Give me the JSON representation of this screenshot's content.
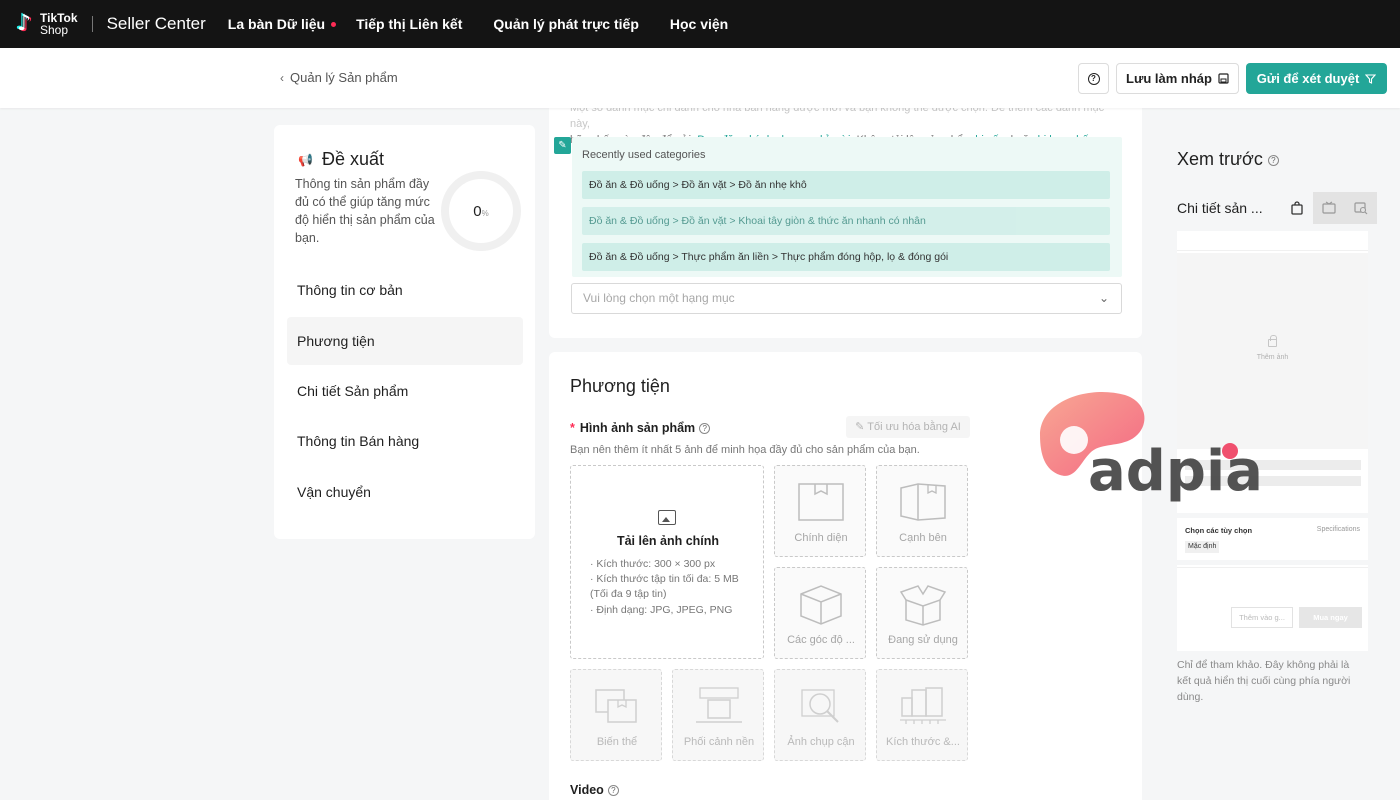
{
  "topnav": {
    "logo_word1": "TikTok",
    "logo_word2": "Shop",
    "brand": "Seller Center",
    "items": [
      {
        "label": "La bàn Dữ liệu",
        "has_dot": true
      },
      {
        "label": "Tiếp thị Liên kết"
      },
      {
        "label": "Quản lý phát trực tiếp"
      },
      {
        "label": "Học viện"
      }
    ]
  },
  "subheader": {
    "back_label": "Quản lý Sản phẩm",
    "help_icon": "question-circle-icon",
    "draft_label": "Lưu làm nháp",
    "submit_label": "Gửi để xét duyệt"
  },
  "colors": {
    "accent": "#23a698",
    "nav_bg": "#141414",
    "required": "#fe2c55"
  },
  "sidebar": {
    "title": "Đề xuất",
    "description": "Thông tin sản phẩm đầy đủ có thể giúp tăng mức độ hiển thị sản phẩm của bạn.",
    "progress_value": "0",
    "progress_unit": "%",
    "progress_fraction": 0,
    "items": [
      {
        "label": "Thông tin cơ bản"
      },
      {
        "label": "Phương tiện",
        "active": true
      },
      {
        "label": "Chi tiết Sản phẩm"
      },
      {
        "label": "Thông tin Bán hàng"
      },
      {
        "label": "Vận chuyển"
      }
    ]
  },
  "category": {
    "note_line1": "Một số danh mục chỉ dành cho nhà bán hàng được mời và bạn không thể được chọn. Để thêm các danh mục này,",
    "note_line2_a": "hãy nhấp vào đây để gửi: ",
    "note_link1": "Đơn đăng ký danh mục chỉ mời",
    "note_line2_b": ". Không tải lên sản phẩm ",
    "note_link2": "bị cấm",
    "note_line2_c": " hoặc ",
    "note_link3": "bị hạn chế",
    "note_line2_d": ".",
    "recent_heading": "Recently used categories",
    "recent": [
      "Đồ ăn & Đồ uống > Đồ ăn vặt > Đồ ăn nhẹ khô",
      "Đồ ăn & Đồ uống > Đồ ăn vặt > Khoai tây giòn & thức ăn nhanh có nhân",
      "Đồ ăn & Đồ uống > Thực phẩm ăn liền > Thực phẩm đóng hộp, lọ & đóng gói"
    ],
    "select_placeholder": "Vui lòng chọn một hạng mục"
  },
  "media": {
    "title": "Phương tiện",
    "images_label": "Hình ảnh sản phẩm",
    "ai_button": "Tối ưu hóa bằng AI",
    "images_hint": "Bạn nên thêm ít nhất 5 ảnh để minh họa đầy đủ cho sản phẩm của bạn.",
    "upload_title": "Tải lên ảnh chính",
    "upload_specs": [
      "· Kích thước: 300 × 300 px",
      "· Kích thước tập tin tối đa: 5 MB",
      "  (Tối đa 9 tập tin)",
      "· Định dạng: JPG, JPEG, PNG"
    ],
    "slots": [
      {
        "label": "Chính diện",
        "icon": "box-front-icon"
      },
      {
        "label": "Cạnh bên",
        "icon": "box-side-icon"
      },
      {
        "label": "Các góc độ ...",
        "icon": "box-angle-icon"
      },
      {
        "label": "Đang sử dụng",
        "icon": "box-open-icon"
      },
      {
        "label": "Biến thể",
        "icon": "variant-icon"
      },
      {
        "label": "Phối cảnh nền",
        "icon": "scene-icon"
      },
      {
        "label": "Ảnh chụp cận",
        "icon": "zoom-icon"
      },
      {
        "label": "Kích thước &...",
        "icon": "ruler-icon"
      }
    ],
    "video_label": "Video"
  },
  "preview": {
    "title": "Xem trước",
    "subtitle": "Chi tiết sản ...",
    "add_image": "Thêm ảnh",
    "options_title": "Chọn các tùy chọn",
    "options_link": "Specifications",
    "options_default": "Mặc định",
    "cart_label": "Thêm vào g...",
    "buy_label": "Mua ngay",
    "note": "Chỉ để tham khảo. Đây không phải là kết quả hiển thị cuối cùng phía người dùng."
  },
  "watermark": {
    "text": "adpia"
  }
}
